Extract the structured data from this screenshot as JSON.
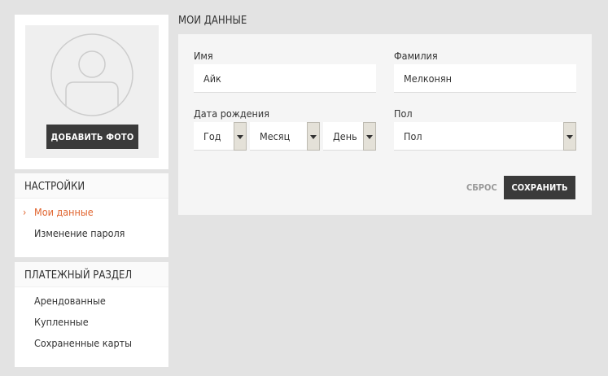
{
  "profile": {
    "add_photo_label": "ДОБАВИТЬ ФОТО"
  },
  "settings_menu": {
    "title": "НАСТРОЙКИ",
    "items": [
      {
        "label": "Мои данные",
        "active": true
      },
      {
        "label": "Изменение пароля",
        "active": false
      }
    ]
  },
  "payments_menu": {
    "title": "ПЛАТЕЖНЫЙ РАЗДЕЛ",
    "items": [
      {
        "label": "Арендованные"
      },
      {
        "label": "Купленные"
      },
      {
        "label": "Сохраненные карты"
      }
    ]
  },
  "page": {
    "title": "МОИ ДАННЫЕ"
  },
  "form": {
    "first_name_label": "Имя",
    "first_name_value": "Айк",
    "last_name_label": "Фамилия",
    "last_name_value": "Мелконян",
    "birth_date_label": "Дата рождения",
    "year_value": "Год",
    "month_value": "Месяц",
    "day_value": "День",
    "gender_label": "Пол",
    "gender_value": "Пол",
    "reset_label": "СБРОС",
    "save_label": "СОХРАНИТЬ"
  },
  "colors": {
    "accent": "#e0632d",
    "dark_button": "#3a3a3a",
    "background": "#e3e3e3"
  }
}
